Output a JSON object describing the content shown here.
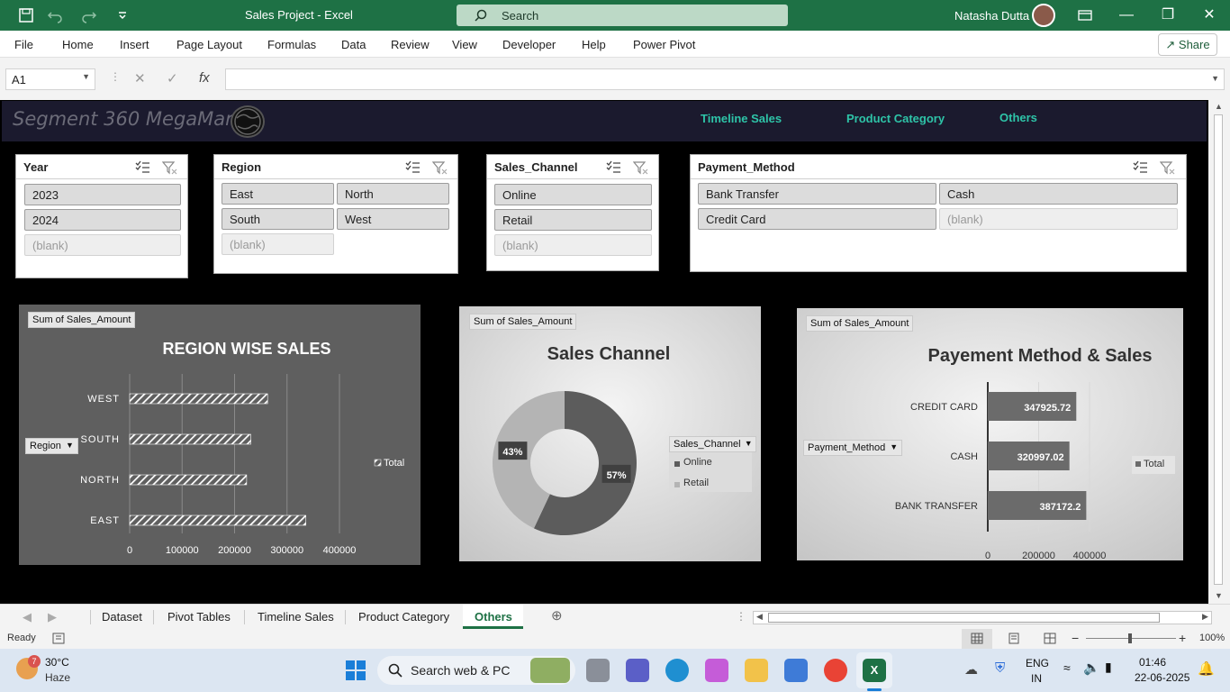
{
  "window": {
    "title": "Sales Project  -  Excel",
    "search_label": "Search",
    "user_name": "Natasha Dutta"
  },
  "menu": {
    "tabs": [
      "File",
      "Home",
      "Insert",
      "Page Layout",
      "Formulas",
      "Data",
      "Review",
      "View",
      "Developer",
      "Help",
      "Power Pivot"
    ],
    "share_label": "Share"
  },
  "formula_bar": {
    "name_box": "A1",
    "fx_label": "fx",
    "formula": ""
  },
  "dashboard": {
    "logo_text": "Segment 360 MegaMart",
    "nav": [
      "Timeline Sales",
      "Product Category",
      "Others"
    ]
  },
  "slicers": {
    "year": {
      "title": "Year",
      "items": [
        "2023",
        "2024",
        "(blank)"
      ]
    },
    "region": {
      "title": "Region",
      "items": [
        "East",
        "North",
        "South",
        "West",
        "(blank)"
      ]
    },
    "sales_channel": {
      "title": "Sales_Channel",
      "items": [
        "Online",
        "Retail",
        "(blank)"
      ]
    },
    "payment_method": {
      "title": "Payment_Method",
      "items": [
        "Bank Transfer",
        "Cash",
        "Credit Card",
        "(blank)"
      ]
    }
  },
  "charts": {
    "region": {
      "field_button": "Sum of Sales_Amount",
      "axis_button": "Region",
      "legend": "Total"
    },
    "channel": {
      "field_button": "Sum of Sales_Amount",
      "legend_button": "Sales_Channel"
    },
    "payment": {
      "field_button": "Sum of Sales_Amount",
      "axis_button": "Payment_Method",
      "legend": "Total"
    }
  },
  "chart_data": [
    {
      "type": "bar",
      "title": "REGION WISE SALES",
      "categories": [
        "WEST",
        "SOUTH",
        "NORTH",
        "EAST"
      ],
      "series": [
        {
          "name": "Total",
          "values": [
            263000,
            231000,
            223000,
            336000
          ]
        }
      ],
      "xlim": [
        0,
        400000
      ],
      "xticks": [
        "0",
        "100000",
        "200000",
        "300000",
        "400000"
      ],
      "grid": true,
      "legend": "right",
      "colors": {
        "background": "#5f5f5f",
        "bar": "#ffffff",
        "text": "#ffffff"
      }
    },
    {
      "type": "pie",
      "title": "Sales Channel",
      "categories": [
        "Online",
        "Retail"
      ],
      "values": [
        57,
        43
      ],
      "labels": [
        "57%",
        "43%"
      ],
      "legend": "right",
      "colors": {
        "Online": "#5c5c5c",
        "Retail": "#b4b4b4"
      }
    },
    {
      "type": "bar",
      "title": "Payement Method & Sales",
      "categories": [
        "CREDIT CARD",
        "CASH",
        "BANK TRANSFER"
      ],
      "series": [
        {
          "name": "Total",
          "values": [
            347925.72,
            320997.02,
            387172.2
          ]
        }
      ],
      "data_labels": [
        "347925.72",
        "320997.02",
        "387172.2"
      ],
      "xlim": [
        0,
        400000
      ],
      "xticks": [
        "0",
        "200000",
        "400000"
      ],
      "grid": true,
      "legend": "right",
      "colors": {
        "bar": "#6b6b6b",
        "text": "#ffffff"
      }
    }
  ],
  "sheet_tabs": [
    "Dataset",
    "Pivot Tables",
    "Timeline Sales",
    "Product Category",
    "Others"
  ],
  "active_tab": "Others",
  "status": {
    "ready": "Ready",
    "zoom": "100%"
  },
  "taskbar": {
    "temperature": "30°C",
    "weather": "Haze",
    "badge": "7",
    "search_placeholder": "Search web & PC",
    "lang": "ENG",
    "lang_region": "IN",
    "time": "01:46",
    "date": "22-06-2025"
  }
}
